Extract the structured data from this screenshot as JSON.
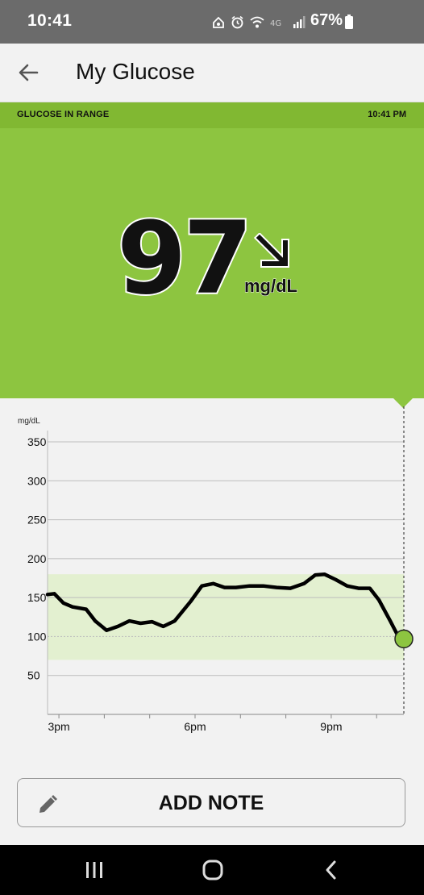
{
  "status_bar": {
    "time": "10:41",
    "battery_pct": "67%",
    "icons": [
      "alarm-house-icon",
      "alarm-icon",
      "wifi-icon",
      "lte-icon",
      "signal-icon",
      "battery-icon"
    ]
  },
  "app_bar": {
    "title": "My Glucose",
    "back_icon": "back-arrow-icon"
  },
  "banner": {
    "label": "GLUCOSE IN RANGE",
    "time": "10:41 PM",
    "color": "#81b832"
  },
  "reading": {
    "value": "97",
    "unit": "mg/dL",
    "trend_icon": "arrow-down-right-icon",
    "color": "#8dc540"
  },
  "chart_data": {
    "type": "line",
    "ylabel": "mg/dL",
    "yticks": [
      50,
      100,
      150,
      200,
      250,
      300,
      350
    ],
    "xtick_labels": [
      "3pm",
      "6pm",
      "9pm"
    ],
    "xtick_hours": [
      15,
      18,
      21
    ],
    "xlim": [
      14.75,
      22.6
    ],
    "ylim": [
      0,
      365
    ],
    "target_range": [
      70,
      180
    ],
    "range_color": "#e3f0d0",
    "line_color": "#000000",
    "current_point_color": "#8dc540",
    "series": [
      {
        "x": [
          14.75,
          14.9,
          15.1,
          15.3,
          15.6,
          15.8,
          16.05,
          16.3,
          16.55,
          16.8,
          17.05,
          17.3,
          17.55,
          17.9,
          18.15,
          18.4,
          18.65,
          18.9,
          19.2,
          19.5,
          19.8,
          20.1,
          20.4,
          20.65,
          20.85,
          21.1,
          21.35,
          21.6,
          21.85,
          22.05,
          22.3,
          22.45,
          22.6
        ],
        "y": [
          154,
          155,
          143,
          138,
          135,
          120,
          108,
          113,
          120,
          117,
          119,
          113,
          120,
          145,
          165,
          168,
          163,
          163,
          165,
          165,
          163,
          162,
          168,
          179,
          180,
          173,
          165,
          162,
          162,
          147,
          120,
          103,
          97
        ]
      }
    ]
  },
  "add_note": {
    "label": "ADD NOTE",
    "icon": "pencil-icon"
  },
  "nav_bar": {
    "buttons": [
      "recents-icon",
      "home-icon",
      "back-icon"
    ]
  }
}
